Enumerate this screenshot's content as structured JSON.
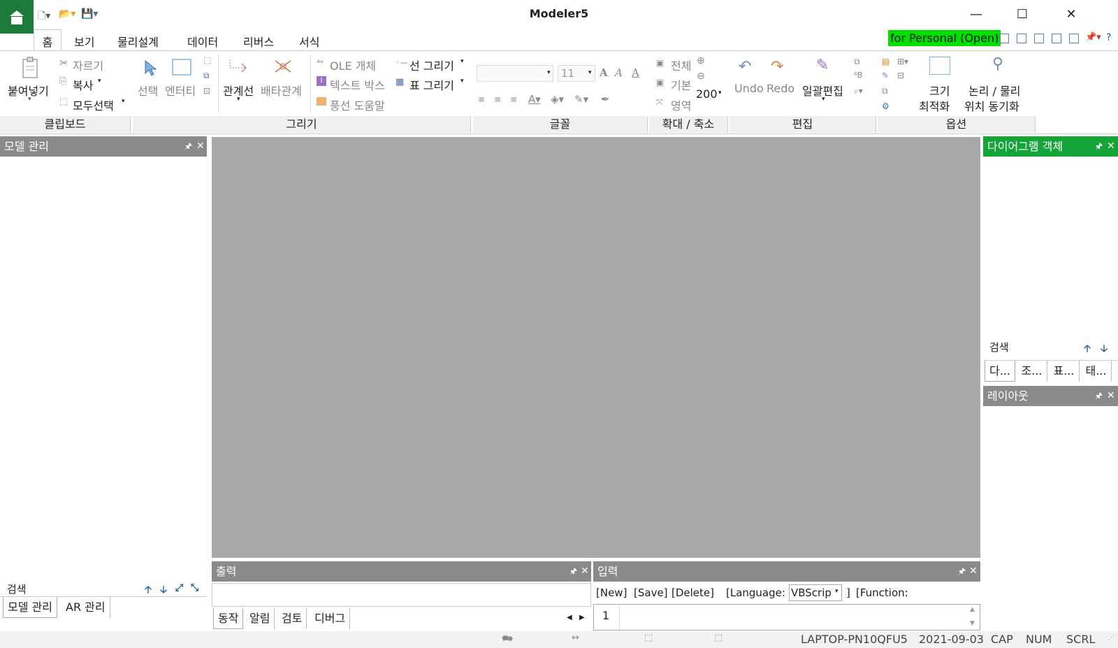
{
  "app": {
    "title": "Modeler5",
    "license_badge": "for Personal (Open)",
    "colors": {
      "brand": "#1e7a3c",
      "accent_green": "#13a538",
      "license_green": "#00e000",
      "canvas": "#a9a9a9"
    }
  },
  "menu": {
    "tabs": [
      "홈",
      "보기",
      "물리설계",
      "데이터",
      "리버스",
      "서식"
    ]
  },
  "ribbon": {
    "clipboard": {
      "paste": "붙여넣기",
      "cut": "자르기",
      "copy": "복사",
      "select_all": "모두선택",
      "label": "클립보드"
    },
    "draw": {
      "select": "선택",
      "entity": "엔터티",
      "relation": "관계선",
      "exclusive": "배타관계",
      "ole": "OLE 개체",
      "textbox": "텍스트 박스",
      "balloon": "풍선 도움말",
      "line": "선 그리기",
      "table": "표 그리기",
      "label": "그리기"
    },
    "font": {
      "size": "11",
      "label": "글꼴"
    },
    "zoom": {
      "all": "전체",
      "basic": "기본",
      "area": "영역",
      "level": "200",
      "label": "확대 / 축소"
    },
    "edit": {
      "undo": "Undo",
      "redo": "Redo",
      "batch": "일괄편집",
      "label": "편집"
    },
    "options": {
      "size_fit_1": "크기",
      "size_fit_2": "최적화",
      "sync_1": "논리 / 물리",
      "sync_2": "위치 동기화",
      "label": "옵션"
    }
  },
  "left_panel": {
    "title": "모델 관리",
    "search_label": "검색",
    "tabs": [
      "모델 관리",
      "AR 관리"
    ]
  },
  "right_panel": {
    "title": "다이어그램 객체",
    "search_label": "검색",
    "tabs": [
      "다...",
      "조...",
      "표...",
      "태..."
    ],
    "layout_title": "레이아웃"
  },
  "output_panel": {
    "title": "출력",
    "tabs": [
      "동작",
      "알림",
      "검토",
      "디버그"
    ]
  },
  "input_panel": {
    "title": "입력",
    "new": "[New]",
    "save": "[Save]",
    "delete": "[Delete]",
    "language_label": "[Language:",
    "language_value": "VBScrip",
    "bracket_close": "]",
    "function_label": "[Function:",
    "line_number": "1"
  },
  "status": {
    "computer": "LAPTOP-PN10QFU5",
    "date": "2021-09-03",
    "cap": "CAP",
    "num": "NUM",
    "scrl": "SCRL"
  }
}
